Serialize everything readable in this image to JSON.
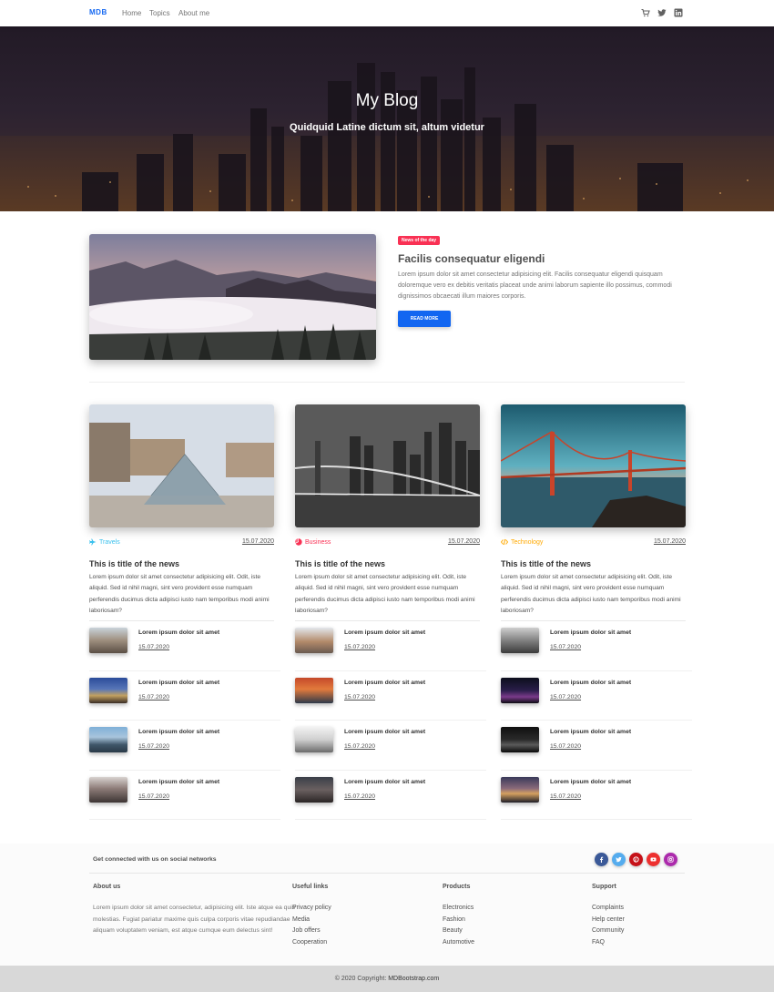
{
  "nav": {
    "brand": "MDB",
    "links": [
      "Home",
      "Topics",
      "About me"
    ],
    "icons": [
      "cart-icon",
      "twitter-icon",
      "linkedin-icon"
    ]
  },
  "hero": {
    "title": "My Blog",
    "subtitle": "Quidquid Latine dictum sit, altum videtur"
  },
  "featured": {
    "badge": "News of the day",
    "title": "Facilis consequatur eligendi",
    "text": "Lorem ipsum dolor sit amet consectetur adipisicing elit. Facilis consequatur eligendi quisquam doloremque vero ex debitis veritatis placeat unde animi laborum sapiente illo possimus, commodi dignissimos obcaecati illum maiores corporis.",
    "button": "READ MORE"
  },
  "columns": [
    {
      "category": "Travels",
      "category_icon": "plane-icon",
      "category_color": "#39c0ed",
      "date": "15.07.2020",
      "title": "This is title of the news",
      "text": "Lorem ipsum dolor sit amet consectetur adipisicing elit. Odit, iste aliquid. Sed id nihil magni, sint vero provident esse numquam perferendis ducimus dicta adipisci iusto nam temporibus modi animi laboriosam?",
      "items": [
        {
          "title": "Lorem ipsum dolor sit amet",
          "date": "15.07.2020"
        },
        {
          "title": "Lorem ipsum dolor sit amet",
          "date": "15.07.2020"
        },
        {
          "title": "Lorem ipsum dolor sit amet",
          "date": "15.07.2020"
        },
        {
          "title": "Lorem ipsum dolor sit amet",
          "date": "15.07.2020"
        }
      ]
    },
    {
      "category": "Business",
      "category_icon": "pie-chart-icon",
      "category_color": "#f93154",
      "date": "15.07.2020",
      "title": "This is title of the news",
      "text": "Lorem ipsum dolor sit amet consectetur adipisicing elit. Odit, iste aliquid. Sed id nihil magni, sint vero provident esse numquam perferendis ducimus dicta adipisci iusto nam temporibus modi animi laboriosam?",
      "items": [
        {
          "title": "Lorem ipsum dolor sit amet",
          "date": "15.07.2020"
        },
        {
          "title": "Lorem ipsum dolor sit amet",
          "date": "15.07.2020"
        },
        {
          "title": "Lorem ipsum dolor sit amet",
          "date": "15.07.2020"
        },
        {
          "title": "Lorem ipsum dolor sit amet",
          "date": "15.07.2020"
        }
      ]
    },
    {
      "category": "Technology",
      "category_icon": "code-icon",
      "category_color": "#ffa900",
      "date": "15.07.2020",
      "title": "This is title of the news",
      "text": "Lorem ipsum dolor sit amet consectetur adipisicing elit. Odit, iste aliquid. Sed id nihil magni, sint vero provident esse numquam perferendis ducimus dicta adipisci iusto nam temporibus modi animi laboriosam?",
      "items": [
        {
          "title": "Lorem ipsum dolor sit amet",
          "date": "15.07.2020"
        },
        {
          "title": "Lorem ipsum dolor sit amet",
          "date": "15.07.2020"
        },
        {
          "title": "Lorem ipsum dolor sit amet",
          "date": "15.07.2020"
        },
        {
          "title": "Lorem ipsum dolor sit amet",
          "date": "15.07.2020"
        }
      ]
    }
  ],
  "footer": {
    "social_text": "Get connected with us on social networks",
    "social_icons": [
      {
        "name": "facebook-icon",
        "color": "#3b5998"
      },
      {
        "name": "twitter-icon",
        "color": "#55acee"
      },
      {
        "name": "pinterest-icon",
        "color": "#c61118"
      },
      {
        "name": "youtube-icon",
        "color": "#ed302f"
      },
      {
        "name": "instagram-icon",
        "color": "#ac2bac"
      }
    ],
    "about": {
      "heading": "About us",
      "text": "Lorem ipsum dolor sit amet consectetur, adipisicing elit. Iste atque ea quis molestias. Fugiat pariatur maxime quis culpa corporis vitae repudiandae aliquam voluptatem veniam, est atque cumque eum delectus sint!"
    },
    "useful": {
      "heading": "Useful links",
      "links": [
        "Privacy policy",
        "Media",
        "Job offers",
        "Cooperation"
      ]
    },
    "products": {
      "heading": "Products",
      "links": [
        "Electronics",
        "Fashion",
        "Beauty",
        "Automotive"
      ]
    },
    "support": {
      "heading": "Support",
      "links": [
        "Complaints",
        "Help center",
        "Community",
        "FAQ"
      ]
    },
    "copyright": "© 2020 Copyright:",
    "copyright_link": "MDBootstrap.com"
  }
}
